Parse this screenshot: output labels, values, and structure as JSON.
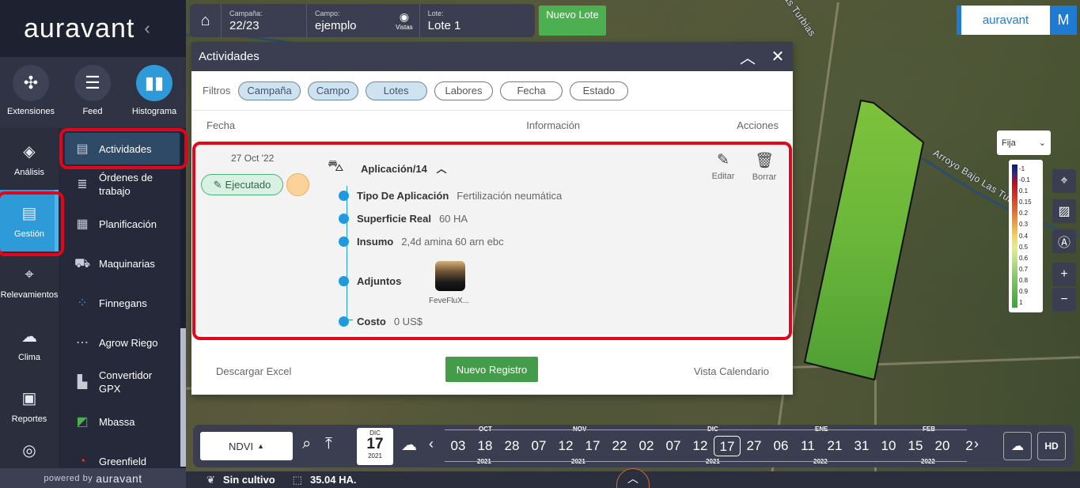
{
  "brand": {
    "logo": "auravant",
    "collapse": "‹",
    "powered_prefix": "powered by",
    "powered_name": "auravant"
  },
  "top_tools": [
    {
      "label": "Extensiones",
      "icon": "puzzle-icon"
    },
    {
      "label": "Feed",
      "icon": "feed-icon"
    },
    {
      "label": "Histograma",
      "icon": "histogram-icon"
    }
  ],
  "sidebar_main": [
    {
      "label": "Análisis",
      "icon": "layers-icon"
    },
    {
      "label": "Gestión",
      "icon": "notebook-icon"
    },
    {
      "label": "Relevamientos",
      "icon": "map-pin-icon"
    },
    {
      "label": "Clima",
      "icon": "cloud-icon"
    },
    {
      "label": "Reportes",
      "icon": "clipboard-icon"
    }
  ],
  "sidebar_sub": [
    {
      "label": "Actividades"
    },
    {
      "label": "Órdenes de trabajo"
    },
    {
      "label": "Planificación"
    },
    {
      "label": "Maquinarias"
    },
    {
      "label": "Finnegans"
    },
    {
      "label": "Agrow Riego"
    },
    {
      "label": "Convertidor GPX"
    },
    {
      "label": "Mbassa"
    },
    {
      "label": "Greenfield"
    }
  ],
  "topbar": {
    "campana_label": "Campaña:",
    "campana_value": "22/23",
    "campo_label": "Campo:",
    "campo_value": "ejemplo",
    "vistas_label": "Vistas",
    "lote_label": "Lote:",
    "lote_value": "Lote 1",
    "new_lote": "Nuevo Lote"
  },
  "brand_right": {
    "name": "auravant",
    "avatar": "M"
  },
  "modal": {
    "title": "Actividades",
    "filters_label": "Filtros",
    "chips": [
      {
        "label": "Campaña",
        "active": true
      },
      {
        "label": "Campo",
        "active": true
      },
      {
        "label": "Lotes",
        "active": true
      },
      {
        "label": "Labores",
        "active": false
      },
      {
        "label": "Fecha",
        "active": false
      },
      {
        "label": "Estado",
        "active": false
      }
    ],
    "col_fecha": "Fecha",
    "col_info": "Información",
    "col_acciones": "Acciones",
    "record": {
      "date": "27 Oct '22",
      "status": "Ejecutado",
      "title": "Aplicación/14",
      "edit": "Editar",
      "delete": "Borrar",
      "fields": [
        {
          "key": "Tipo De Aplicación",
          "value": "Fertilización neumática"
        },
        {
          "key": "Superficie Real",
          "value": "60 HA"
        },
        {
          "key": "Insumo",
          "value": "2,4d amina 60 arn ebc"
        },
        {
          "key": "Adjuntos",
          "value": ""
        },
        {
          "key": "Costo",
          "value": "0 US$"
        }
      ],
      "attachment_name": "FeveFluX..."
    },
    "footer": {
      "excel": "Descargar Excel",
      "nuevo": "Nuevo Registro",
      "calendar": "Vista Calendario"
    }
  },
  "map": {
    "river_label_1": "Arroyo Bajo Las Turbias",
    "river_label_2": "Las Turbias",
    "mode": "Fija",
    "legend": [
      "-1",
      "-0.1",
      "0.1",
      "0.15",
      "0.2",
      "0.3",
      "0.4",
      "0.5",
      "0.6",
      "0.7",
      "0.8",
      "0.9",
      "1"
    ],
    "zoom_in": "+",
    "zoom_out": "−"
  },
  "timeline": {
    "index": "NDVI",
    "cal_month": "DIC",
    "cal_day": "17",
    "cal_year": "2021",
    "days": [
      "03",
      "18",
      "28",
      "07",
      "12",
      "17",
      "22",
      "02",
      "07",
      "12",
      "17",
      "27",
      "06",
      "11",
      "21",
      "31",
      "10",
      "15",
      "20",
      "2"
    ],
    "selected_index": 10,
    "months": [
      {
        "label": "OCT",
        "at": 1
      },
      {
        "label": "NOV",
        "at": 4.5
      },
      {
        "label": "DIC",
        "at": 9.5
      },
      {
        "label": "ENE",
        "at": 13.5
      },
      {
        "label": "FEB",
        "at": 17.5
      }
    ],
    "years": [
      {
        "label": "2021",
        "at": 1
      },
      {
        "label": "2021",
        "at": 4.5
      },
      {
        "label": "2021",
        "at": 9.5
      },
      {
        "label": "2022",
        "at": 13.5
      },
      {
        "label": "2022",
        "at": 17.5
      }
    ],
    "hd": "HD"
  },
  "status": {
    "crop": "Sin cultivo",
    "area": "35.04 HA."
  }
}
